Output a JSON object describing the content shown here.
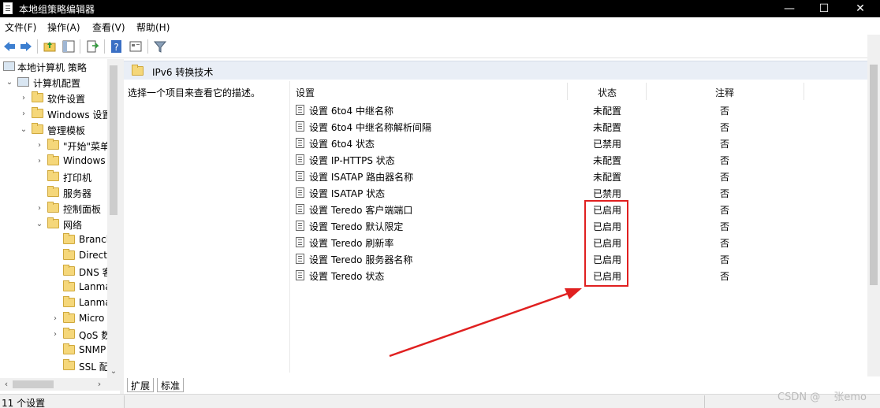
{
  "window": {
    "title": "本地组策略编辑器",
    "minimize_icon": "—",
    "maximize_icon": "☐",
    "close_icon": "✕"
  },
  "menu": [
    {
      "label": "文件(F)"
    },
    {
      "label": "操作(A)"
    },
    {
      "label": "查看(V)"
    },
    {
      "label": "帮助(H)"
    }
  ],
  "toolbar_icons": [
    "back-icon",
    "forward-icon",
    "up-folder-icon",
    "show-hide-tree-icon",
    "export-list-icon",
    "help-icon",
    "properties-icon",
    "filter-icon"
  ],
  "tree": [
    {
      "label": "本地计算机 策略",
      "indent": 0,
      "expander": "",
      "icon": "policy"
    },
    {
      "label": "计算机配置",
      "indent": 1,
      "expander": "⌄",
      "icon": "computer"
    },
    {
      "label": "软件设置",
      "indent": 2,
      "expander": "›",
      "icon": "folder"
    },
    {
      "label": "Windows 设置",
      "indent": 2,
      "expander": "›",
      "icon": "folder"
    },
    {
      "label": "管理模板",
      "indent": 2,
      "expander": "⌄",
      "icon": "folder"
    },
    {
      "label": "\"开始\"菜单",
      "indent": 3,
      "expander": "›",
      "icon": "folder"
    },
    {
      "label": "Windows",
      "indent": 3,
      "expander": "›",
      "icon": "folder"
    },
    {
      "label": "打印机",
      "indent": 3,
      "expander": "",
      "icon": "folder"
    },
    {
      "label": "服务器",
      "indent": 3,
      "expander": "",
      "icon": "folder"
    },
    {
      "label": "控制面板",
      "indent": 3,
      "expander": "›",
      "icon": "folder"
    },
    {
      "label": "网络",
      "indent": 3,
      "expander": "⌄",
      "icon": "folder"
    },
    {
      "label": "Branch",
      "indent": 4,
      "expander": "",
      "icon": "folder"
    },
    {
      "label": "Direct",
      "indent": 4,
      "expander": "",
      "icon": "folder"
    },
    {
      "label": "DNS 客",
      "indent": 4,
      "expander": "",
      "icon": "folder"
    },
    {
      "label": "Lanma",
      "indent": 4,
      "expander": "",
      "icon": "folder"
    },
    {
      "label": "Lanma",
      "indent": 4,
      "expander": "",
      "icon": "folder"
    },
    {
      "label": "Micro",
      "indent": 4,
      "expander": "›",
      "icon": "folder"
    },
    {
      "label": "QoS 数",
      "indent": 4,
      "expander": "›",
      "icon": "folder"
    },
    {
      "label": "SNMP",
      "indent": 4,
      "expander": "",
      "icon": "folder"
    },
    {
      "label": "SSL 配",
      "indent": 4,
      "expander": "",
      "icon": "folder"
    }
  ],
  "right_pane": {
    "header_title": "IPv6 转换技术",
    "description": "选择一个项目来查看它的描述。",
    "columns": {
      "setting": "设置",
      "state": "状态",
      "note": "注释"
    },
    "rows": [
      {
        "name": "设置 6to4 中继名称",
        "state": "未配置",
        "note": "否"
      },
      {
        "name": "设置 6to4 中继名称解析间隔",
        "state": "未配置",
        "note": "否"
      },
      {
        "name": "设置 6to4 状态",
        "state": "已禁用",
        "note": "否"
      },
      {
        "name": "设置 IP-HTTPS 状态",
        "state": "未配置",
        "note": "否"
      },
      {
        "name": "设置 ISATAP 路由器名称",
        "state": "未配置",
        "note": "否"
      },
      {
        "name": "设置 ISATAP 状态",
        "state": "已禁用",
        "note": "否"
      },
      {
        "name": "设置 Teredo 客户端端口",
        "state": "已启用",
        "note": "否"
      },
      {
        "name": "设置 Teredo 默认限定",
        "state": "已启用",
        "note": "否"
      },
      {
        "name": "设置 Teredo 刷新率",
        "state": "已启用",
        "note": "否"
      },
      {
        "name": "设置 Teredo 服务器名称",
        "state": "已启用",
        "note": "否"
      },
      {
        "name": "设置 Teredo 状态",
        "state": "已启用",
        "note": "否"
      }
    ]
  },
  "tabs": [
    {
      "label": "扩展"
    },
    {
      "label": "标准"
    }
  ],
  "status": {
    "text": "11 个设置"
  },
  "watermark": "CSDN @　 张emo",
  "annotation_color": "#e02020"
}
